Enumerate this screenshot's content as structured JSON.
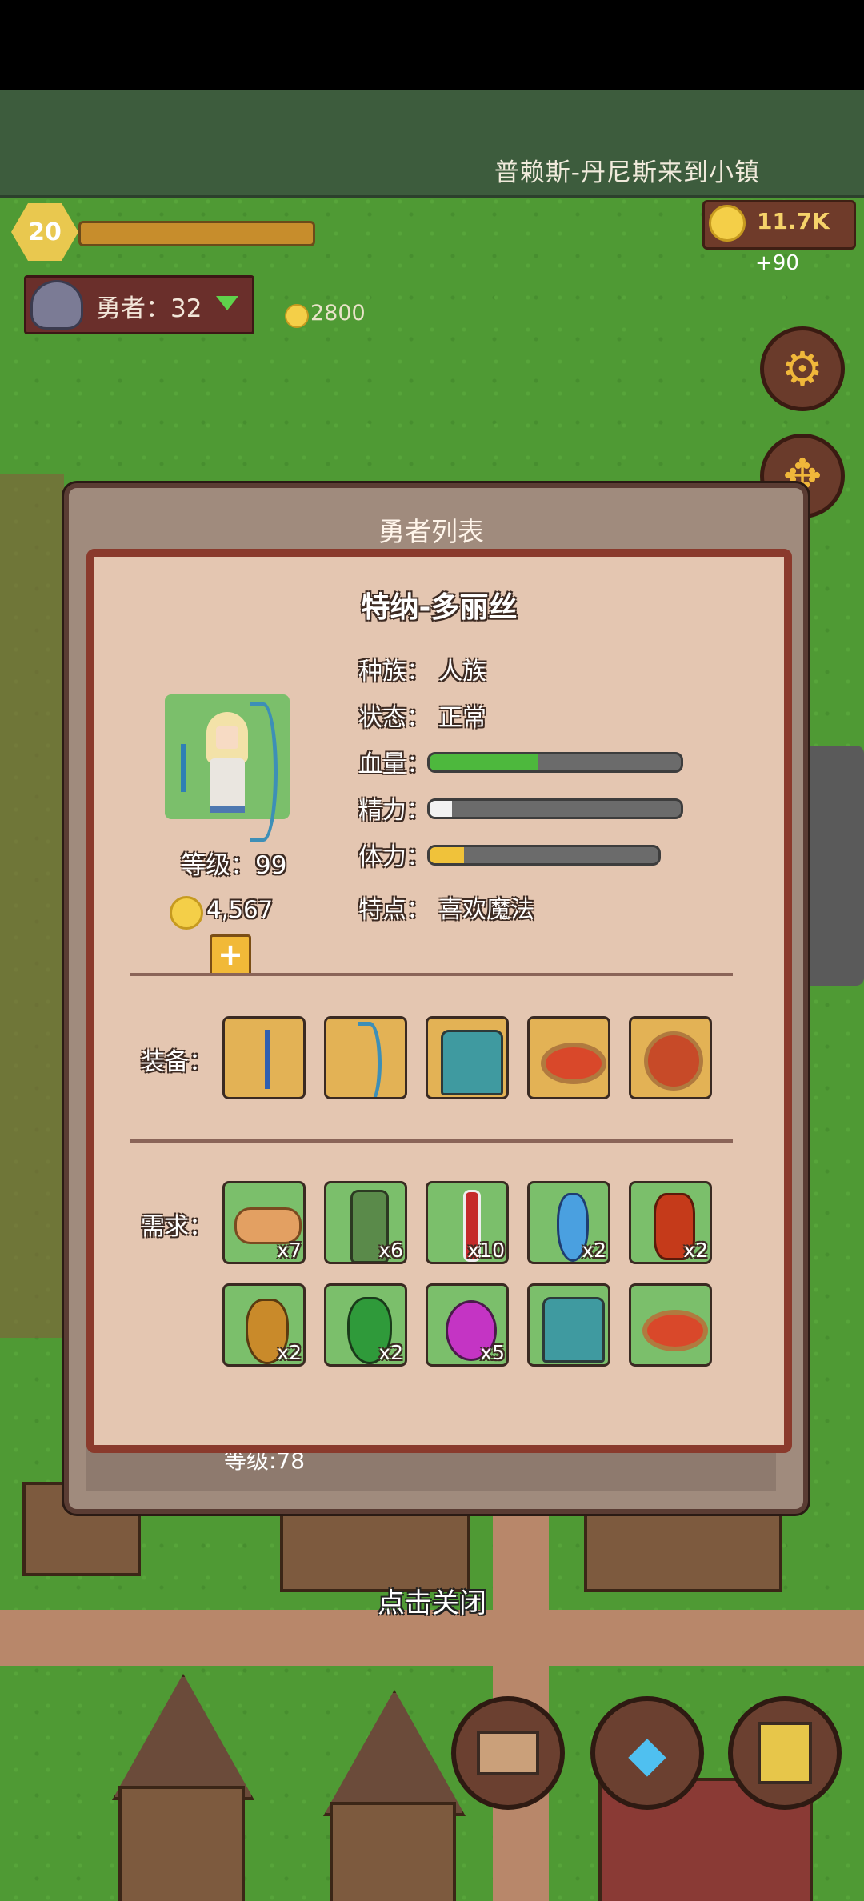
{
  "news": "普赖斯-丹尼斯来到小镇",
  "player": {
    "level": "20",
    "coins": "11.7K",
    "coins_delta": "+90"
  },
  "heroes": {
    "label": "勇者：32",
    "cost": "2800"
  },
  "modal": {
    "title": "勇者列表",
    "hero_name": "特纳-多丽丝",
    "level": "等级：99",
    "gold": "4,567",
    "stats": {
      "race_label": "种族：",
      "race_value": "人族",
      "status_label": "状态：",
      "status_value": "正常",
      "hp_label": "血量：",
      "energy_label": "精力：",
      "stamina_label": "体力：",
      "trait_label": "特点：",
      "trait_value": "喜欢魔法"
    },
    "bars": {
      "hp": 0.43,
      "energy": 0.09,
      "stamina": 0.15
    },
    "equipment_label": "装备：",
    "demand_label": "需求：",
    "equipment": [
      "arrow-icon",
      "bow-icon",
      "chest-armor-icon",
      "ring-icon",
      "amulet-icon"
    ],
    "demand": [
      {
        "icon": "bread-icon",
        "qty": "x7"
      },
      {
        "icon": "wine-bottle-icon",
        "qty": "x6"
      },
      {
        "icon": "red-vial-icon",
        "qty": "x10"
      },
      {
        "icon": "blue-potion-icon",
        "qty": "x2"
      },
      {
        "icon": "red-crystal-icon",
        "qty": "x2"
      },
      {
        "icon": "gourd-icon",
        "qty": "x2"
      },
      {
        "icon": "green-potion-icon",
        "qty": "x2"
      },
      {
        "icon": "purple-potion-icon",
        "qty": "x5"
      },
      {
        "icon": "chest-armor-icon",
        "qty": ""
      },
      {
        "icon": "ring-icon",
        "qty": ""
      }
    ],
    "behind_row_level": "等级:78",
    "close_hint": "点击关闭"
  },
  "colors": {
    "hp": "#4db83d",
    "energy": "#f2f2f2",
    "stamina": "#f0c23a"
  }
}
